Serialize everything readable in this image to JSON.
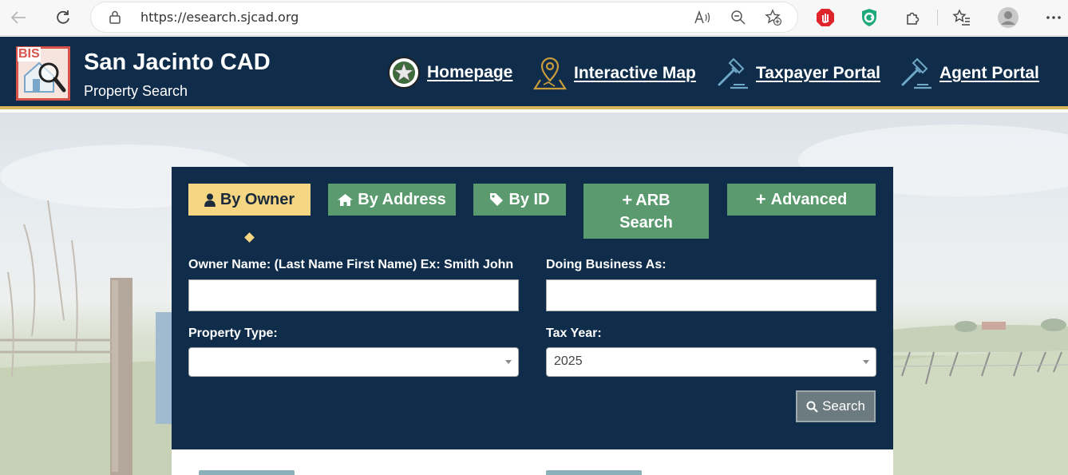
{
  "browser": {
    "url": "https://esearch.sjcad.org",
    "icons": [
      "back-icon",
      "refresh-icon",
      "lock-icon",
      "read-aloud-icon",
      "zoom-out-icon",
      "add-favorite-icon",
      "adblock-icon",
      "shield-extension-icon",
      "extensions-icon",
      "favorites-icon",
      "profile-icon",
      "more-icon"
    ]
  },
  "header": {
    "logo_text": "BIS",
    "title": "San Jacinto CAD",
    "subtitle": "Property Search",
    "nav": [
      {
        "label": "Homepage",
        "icon": "star-seal-icon"
      },
      {
        "label": "Interactive Map",
        "icon": "map-pin-icon"
      },
      {
        "label": "Taxpayer Portal",
        "icon": "gavel-icon"
      },
      {
        "label": "Agent Portal",
        "icon": "gavel-icon"
      }
    ]
  },
  "colors": {
    "header_bg": "#0f2d4a",
    "accent_gold": "#d9b55c",
    "tab_active": "#f5d683",
    "tab_inactive": "#5a9a6e"
  },
  "tabs": [
    {
      "label": "By Owner",
      "icon": "user-icon",
      "active": true
    },
    {
      "label": "By Address",
      "icon": "home-icon",
      "active": false
    },
    {
      "label": "By ID",
      "icon": "tag-icon",
      "active": false
    },
    {
      "label_line1": "ARB",
      "label_line2": "Search",
      "icon": "plus-icon",
      "active": false
    },
    {
      "label": "Advanced",
      "icon": "plus-icon",
      "active": false
    }
  ],
  "form": {
    "owner_label": "Owner Name: (Last Name First Name) Ex: Smith John",
    "owner_value": "",
    "dba_label": "Doing Business As:",
    "dba_value": "",
    "property_type_label": "Property Type:",
    "property_type_value": "",
    "tax_year_label": "Tax Year:",
    "tax_year_value": "2025",
    "search_label": "Search"
  }
}
